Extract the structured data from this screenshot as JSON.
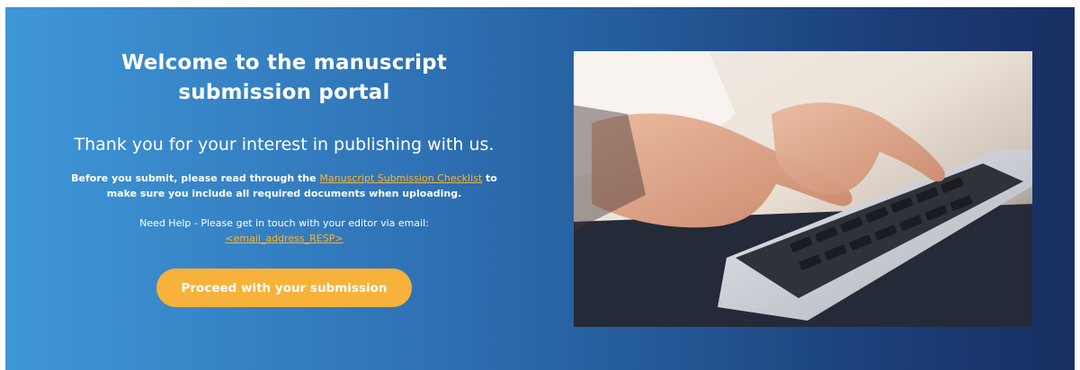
{
  "hero": {
    "title": "Welcome to the manuscript submission portal",
    "subtitle": "Thank you for your interest in publishing with us.",
    "checklist_prefix": "Before you submit, please read through the ",
    "checklist_link": "Manuscript Submission Checklist",
    "checklist_suffix": " to make sure you include all required documents when uploading.",
    "help_text": "Need Help - Please get in touch with your editor via email:",
    "email_link": "<email_address_RESP>",
    "cta_label": "Proceed with your submission"
  },
  "colors": {
    "gradient_start": "#3f97d8",
    "gradient_end": "#182f62",
    "accent": "#f7b23b",
    "link": "#f6b43c"
  }
}
